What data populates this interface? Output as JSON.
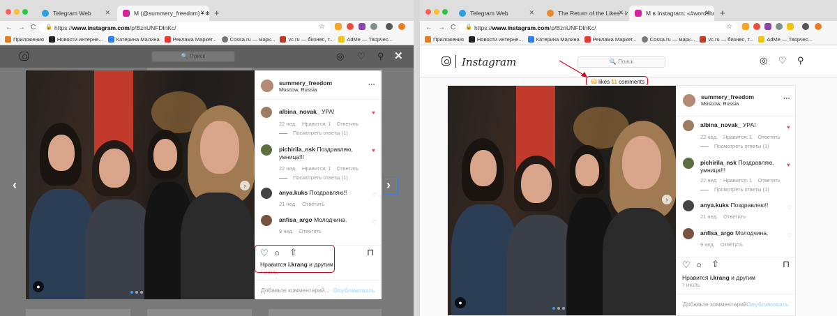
{
  "colors": {
    "accent_red": "#d0021b",
    "heart": "#ed4956",
    "link_blue": "#3897f0",
    "publish_disabled": "#b2dffc",
    "stats_highlight": "#f5a623"
  },
  "left_window": {
    "tabs": [
      {
        "title": "Telegram Web",
        "icon": "telegram-icon"
      },
      {
        "title": "M (@summery_freedom) • Фот",
        "icon": "instagram-icon"
      }
    ],
    "new_tab": "+",
    "url": {
      "prefix": "https://",
      "host": "www.instagram.com",
      "path": "/p/BznUNFDlnKc/"
    },
    "bookmarks": [
      {
        "label": "Приложения",
        "icon": "apps-grid-icon"
      },
      {
        "label": "Новости интерне...",
        "icon": "t-icon"
      },
      {
        "label": "Катерина Малина",
        "icon": "blue-square-icon"
      },
      {
        "label": "Реклама Маркет...",
        "icon": "s-icon"
      },
      {
        "label": "Cossa.ru — марк...",
        "icon": "cossa-icon"
      },
      {
        "label": "vc.ru — бизнес, т...",
        "icon": "vc-icon"
      },
      {
        "label": "AdMe — Творчес...",
        "icon": "adme-icon"
      }
    ],
    "search_placeholder": "Поиск",
    "modal": {
      "author": {
        "username": "summery_freedom",
        "location": "Moscow, Russia"
      },
      "comments": [
        {
          "username": "albina_novak_",
          "text": "УРА!",
          "time": "22 нед.",
          "likes": "Нравится: 1",
          "reply": "Ответить",
          "view_replies": "Посмотреть ответы (1)",
          "liked": true
        },
        {
          "username": "pichirila_nsk",
          "text": "Поздравляю, умница!!!",
          "time": "22 нед.",
          "likes": "Нравится: 1",
          "reply": "Ответить",
          "view_replies": "Посмотреть ответы (1)",
          "liked": true
        },
        {
          "username": "anya.kuks",
          "text": "Поздравляю!!",
          "time": "21 нед.",
          "reply": "Ответить",
          "liked": false
        },
        {
          "username": "anfisa_argo",
          "text": "Молодчина.",
          "time": "9 нед.",
          "reply": "Ответить",
          "liked": false
        }
      ],
      "likes_prefix": "Нравится",
      "likes_user": "i.krang",
      "likes_suffix": "и другим",
      "date": "7 ИЮЛЬ",
      "add_comment_placeholder": "Добавьте комментарий...",
      "publish": "Опубликовать"
    }
  },
  "right_window": {
    "tabs": [
      {
        "title": "Telegram Web",
        "icon": "telegram-icon"
      },
      {
        "title": "The Return of the Likes - Интер",
        "icon": "likes-icon"
      },
      {
        "title": "M в Instagram: «#wordshop - ...",
        "icon": "instagram-icon"
      }
    ],
    "new_tab": "+",
    "url": {
      "prefix": "https://",
      "host": "www.instagram.com",
      "path": "/p/BznUNFDlnKc/"
    },
    "bookmarks": [
      {
        "label": "Приложения",
        "icon": "apps-grid-icon"
      },
      {
        "label": "Новости интерне...",
        "icon": "t-icon"
      },
      {
        "label": "Катерина Малина",
        "icon": "blue-square-icon"
      },
      {
        "label": "Реклама Маркет...",
        "icon": "s-icon"
      },
      {
        "label": "Cossa.ru — марк...",
        "icon": "cossa-icon"
      },
      {
        "label": "vc.ru — бизнес, т...",
        "icon": "vc-icon"
      },
      {
        "label": "AdMe — Творчес...",
        "icon": "adme-icon"
      }
    ],
    "logo": "Instagram",
    "search_placeholder": "Поиск",
    "stats": {
      "likes_count": "63",
      "likes_label": "likes",
      "comments_count": "11",
      "comments_label": "comments"
    },
    "post": {
      "author": {
        "username": "summery_freedom",
        "location": "Moscow, Russia"
      },
      "comments": [
        {
          "username": "albina_novak_",
          "text": "УРА!",
          "time": "22 нед.",
          "likes": "Нравится: 1",
          "reply": "Ответить",
          "view_replies": "Посмотреть ответы (1)",
          "liked": true
        },
        {
          "username": "pichirila_nsk",
          "text": "Поздравляю, умница!!!",
          "time": "22 нед.",
          "likes": "Нравится: 1",
          "reply": "Ответить",
          "view_replies": "Посмотреть ответы (1)",
          "liked": true
        },
        {
          "username": "anya.kuks",
          "text": "Поздравляю!!",
          "time": "21 нед.",
          "reply": "Ответить",
          "liked": false
        },
        {
          "username": "anfisa_argo",
          "text": "Молодчина.",
          "time": "9 нед.",
          "reply": "Ответить",
          "liked": false
        }
      ],
      "likes_prefix": "Нравится",
      "likes_user": "i.krang",
      "likes_suffix": "и другим",
      "date": "7 ИЮЛЬ",
      "add_comment_placeholder": "Добавьте комментарий...",
      "publish": "Опубликовать"
    }
  }
}
